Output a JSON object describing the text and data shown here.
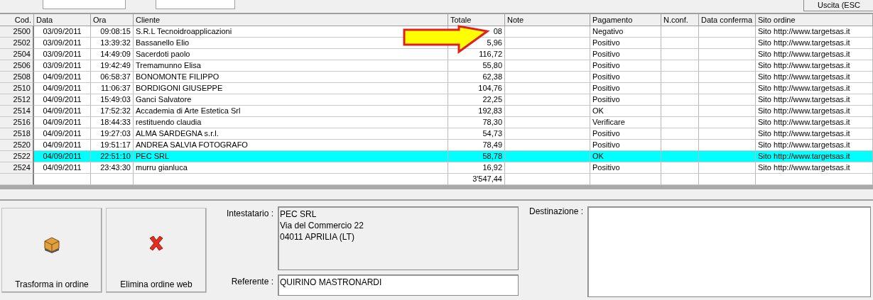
{
  "toolbar": {
    "exit_button": "Uscita (ESC"
  },
  "table": {
    "columns": [
      "Cod.",
      "Data",
      "Ora",
      "Cliente",
      "Totale",
      "Note",
      "Pagamento",
      "N.conf.",
      "Data conferma",
      "Sito ordine"
    ],
    "rows": [
      {
        "cod": "2500",
        "data": "03/09/2011",
        "ora": "09:08:15",
        "cliente": "S.R.L Tecnoidroapplicazioni",
        "totale": "08",
        "pagamento": "Negativo",
        "sito": "Sito http://www.targetsas.it",
        "selected": false
      },
      {
        "cod": "2502",
        "data": "03/09/2011",
        "ora": "13:39:32",
        "cliente": "Bassanello Elio",
        "totale": "5,96",
        "pagamento": "Positivo",
        "sito": "Sito http://www.targetsas.it",
        "selected": false
      },
      {
        "cod": "2504",
        "data": "03/09/2011",
        "ora": "14:49:09",
        "cliente": "Sacerdoti paolo",
        "totale": "116,72",
        "pagamento": "Positivo",
        "sito": "Sito http://www.targetsas.it",
        "selected": false
      },
      {
        "cod": "2506",
        "data": "03/09/2011",
        "ora": "19:42:49",
        "cliente": "Tremamunno Elisa",
        "totale": "55,80",
        "pagamento": "Positivo",
        "sito": "Sito http://www.targetsas.it",
        "selected": false
      },
      {
        "cod": "2508",
        "data": "04/09/2011",
        "ora": "06:58:37",
        "cliente": "BONOMONTE FILIPPO",
        "totale": "62,38",
        "pagamento": "Positivo",
        "sito": "Sito http://www.targetsas.it",
        "selected": false
      },
      {
        "cod": "2510",
        "data": "04/09/2011",
        "ora": "11:06:37",
        "cliente": "BORDIGONI GIUSEPPE",
        "totale": "104,76",
        "pagamento": "Positivo",
        "sito": "Sito http://www.targetsas.it",
        "selected": false
      },
      {
        "cod": "2512",
        "data": "04/09/2011",
        "ora": "15:49:03",
        "cliente": "Ganci Salvatore",
        "totale": "22,25",
        "pagamento": "Positivo",
        "sito": "Sito http://www.targetsas.it",
        "selected": false
      },
      {
        "cod": "2514",
        "data": "04/09/2011",
        "ora": "17:52:32",
        "cliente": "Accademia di Arte Estetica Srl",
        "totale": "192,83",
        "pagamento": "OK",
        "sito": "Sito http://www.targetsas.it",
        "selected": false
      },
      {
        "cod": "2516",
        "data": "04/09/2011",
        "ora": "18:44:33",
        "cliente": "restituendo claudia",
        "totale": "78,30",
        "pagamento": "Verificare",
        "sito": "Sito http://www.targetsas.it",
        "selected": false
      },
      {
        "cod": "2518",
        "data": "04/09/2011",
        "ora": "19:27:03",
        "cliente": "ALMA SARDEGNA s.r.l.",
        "totale": "54,73",
        "pagamento": "Positivo",
        "sito": "Sito http://www.targetsas.it",
        "selected": false
      },
      {
        "cod": "2520",
        "data": "04/09/2011",
        "ora": "19:51:17",
        "cliente": "ANDREA SALVIA FOTOGRAFO",
        "totale": "78,49",
        "pagamento": "Positivo",
        "sito": "Sito http://www.targetsas.it",
        "selected": false
      },
      {
        "cod": "2522",
        "data": "04/09/2011",
        "ora": "22:51:10",
        "cliente": "PEC SRL",
        "totale": "58,78",
        "pagamento": "OK",
        "sito": "Sito http://www.targetsas.it",
        "selected": true
      },
      {
        "cod": "2524",
        "data": "04/09/2011",
        "ora": "23:43:30",
        "cliente": "murru gianluca",
        "totale": "16,92",
        "pagamento": "Positivo",
        "sito": "Sito http://www.targetsas.it",
        "selected": false
      }
    ],
    "total": "3'547,44"
  },
  "actions": [
    {
      "kind": "box",
      "label": "Trasforma in ordine"
    },
    {
      "kind": "delete",
      "label": "Elimina ordine web"
    }
  ],
  "details": {
    "intestatario_label": "Intestatario :",
    "intestatario_lines": [
      "PEC SRL",
      "Via del Commercio 22",
      "04011 APRILIA (LT)"
    ],
    "referente_label": "Referente :",
    "referente": "QUIRINO MASTRONARDI",
    "destinazione_label": "Destinazione :"
  }
}
